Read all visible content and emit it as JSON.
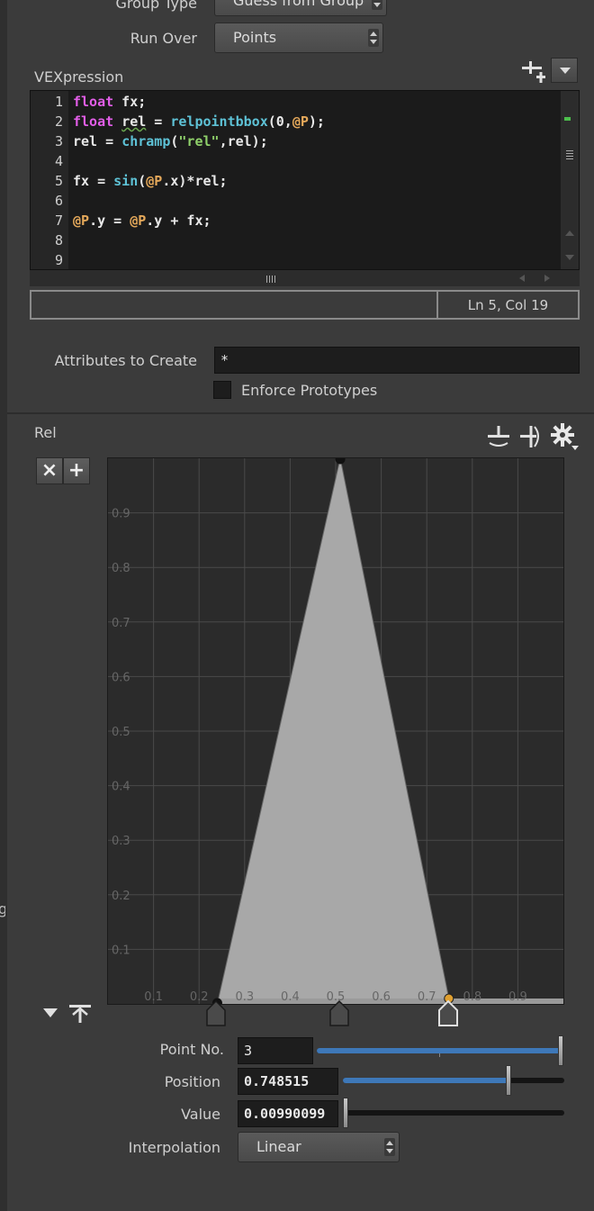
{
  "params": {
    "group_type_label": "Group Type",
    "group_type_value": "Guess from Group",
    "run_over_label": "Run Over",
    "run_over_value": "Points"
  },
  "vex": {
    "title": "VEXpression",
    "line_numbers": [
      "1",
      "2",
      "3",
      "4",
      "5",
      "6",
      "7",
      "8",
      "9"
    ],
    "status": "Ln 5, Col 19"
  },
  "attributes": {
    "label": "Attributes to Create",
    "value": "*",
    "enforce_label": "Enforce Prototypes"
  },
  "ramp": {
    "label": "Rel",
    "remove_label": "×",
    "add_label": "+",
    "x_ticks": [
      "0.1",
      "0.2",
      "0.3",
      "0.4",
      "0.5",
      "0.6",
      "0.7",
      "0.8",
      "0.9"
    ],
    "y_ticks": [
      "0.1",
      "0.2",
      "0.3",
      "0.4",
      "0.5",
      "0.6",
      "0.7",
      "0.8",
      "0.9"
    ],
    "points": [
      {
        "pos": 0.24,
        "value": 0.0
      },
      {
        "pos": 0.51,
        "value": 1.0
      },
      {
        "pos": 0.748515,
        "value": 0.00990099
      }
    ],
    "selected_point": 3,
    "fill_color": "#a8a8a8",
    "selected_color": "#e0a030"
  },
  "point_controls": {
    "point_no_label": "Point No.",
    "point_no_value": "3",
    "point_no_fraction": 1.0,
    "position_label": "Position",
    "position_value": "0.748515",
    "position_fraction": 0.748515,
    "value_label": "Value",
    "value_value": "0.00990099",
    "value_fraction": 0.0099,
    "interp_label": "Interpolation",
    "interp_value": "Linear"
  }
}
